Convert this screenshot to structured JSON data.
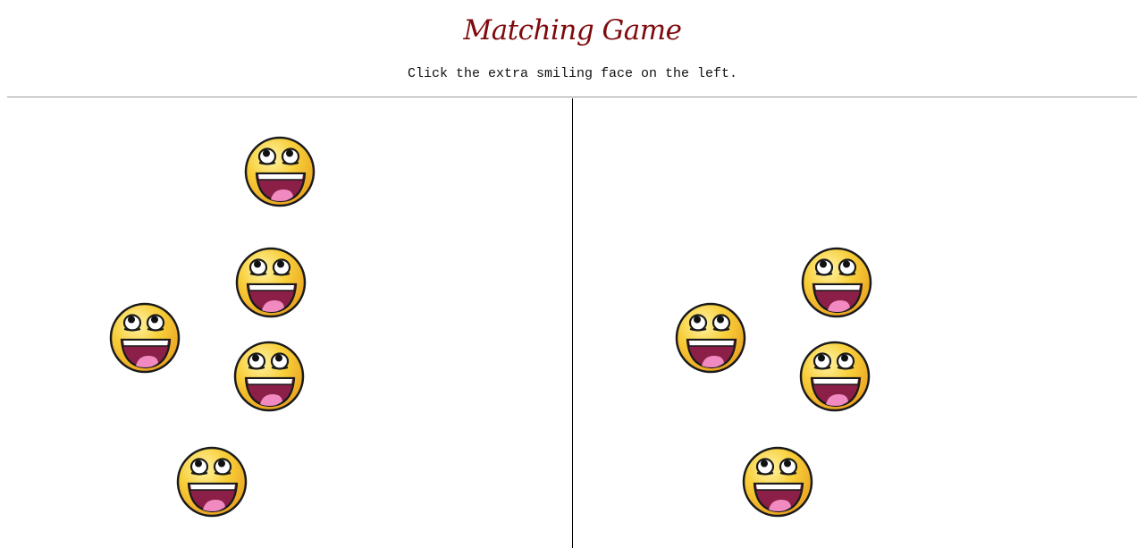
{
  "title": "Matching Game",
  "instructions": "Click the extra smiling face on the left.",
  "colors": {
    "title": "#7f0a0d",
    "face_fill": "#f8cf3a",
    "face_outline": "#1a1a1a",
    "mouth": "#8b1f47",
    "tongue": "#f08ac0"
  },
  "game": {
    "left_side": {
      "face_count": 5,
      "icon": "awesome-smiley-face-icon"
    },
    "right_side": {
      "face_count": 4,
      "icon": "awesome-smiley-face-icon"
    }
  }
}
